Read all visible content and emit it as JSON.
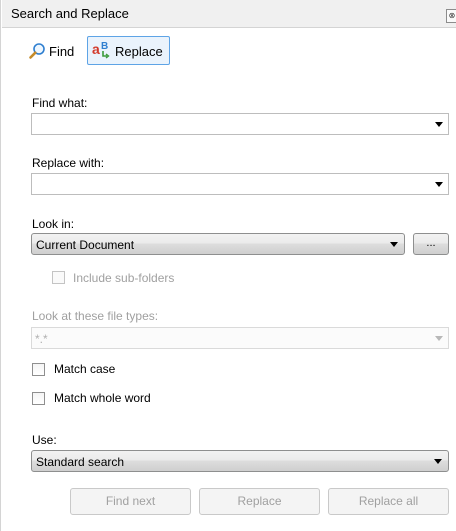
{
  "window": {
    "title": "Search and Replace",
    "close_glyph": "⊗"
  },
  "tabs": [
    {
      "label": "Find",
      "icon": "magnifier-icon"
    },
    {
      "label": "Replace",
      "icon": "replace-icon"
    }
  ],
  "find_what": {
    "label": "Find what:",
    "value": ""
  },
  "replace_with": {
    "label": "Replace with:",
    "value": ""
  },
  "look_in": {
    "label": "Look in:",
    "value": "Current Document",
    "browse_label": "..."
  },
  "include_subfolders": {
    "label": "Include sub-folders",
    "checked": false
  },
  "file_types": {
    "label": "Look at these file types:",
    "value": "*.*"
  },
  "match_case": {
    "label": "Match case",
    "checked": false
  },
  "match_whole_word": {
    "label": "Match whole word",
    "checked": false
  },
  "use": {
    "label": "Use:",
    "value": "Standard search"
  },
  "buttons": {
    "find_next": "Find next",
    "replace": "Replace",
    "replace_all": "Replace all"
  },
  "colors": {
    "tab_active_border": "#5ea4e6",
    "tab_active_bg": "#eaf3fc",
    "disabled_text": "#a0a0a0"
  }
}
